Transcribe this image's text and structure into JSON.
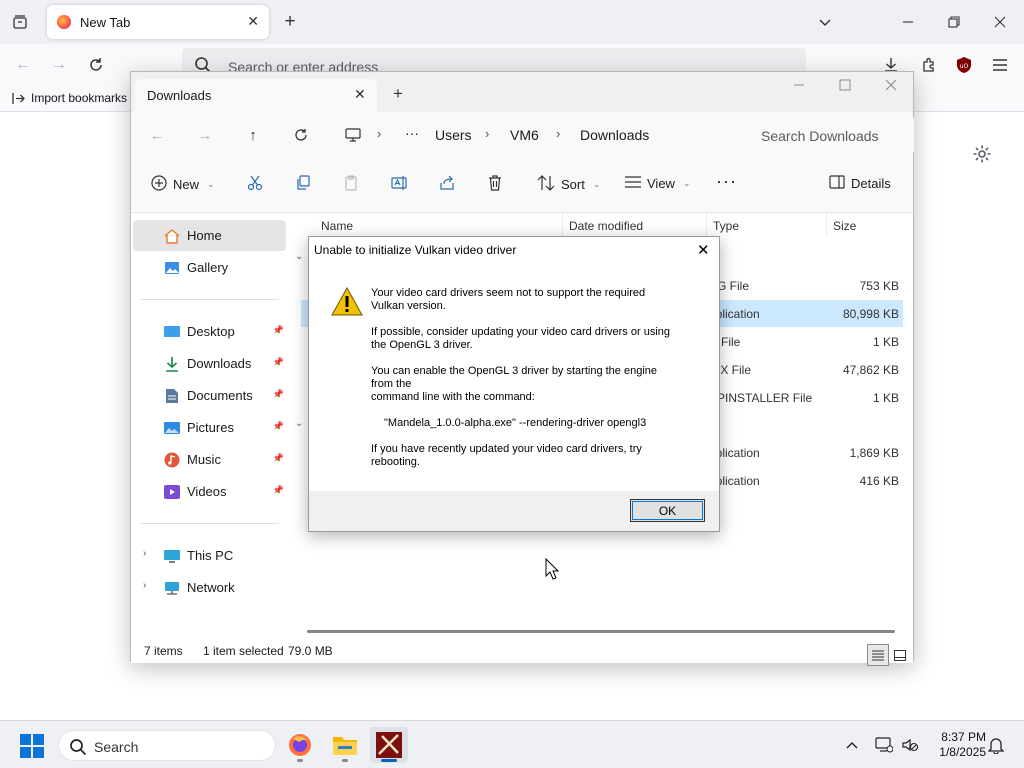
{
  "browser": {
    "tab_title": "New Tab",
    "address_placeholder": "Search or enter address",
    "import_bookmarks": "Import bookmarks"
  },
  "explorer": {
    "tab_title": "Downloads",
    "breadcrumb": [
      "Users",
      "VM6",
      "Downloads"
    ],
    "breadcrumb_more": "···",
    "search_placeholder": "Search Downloads",
    "toolbar": {
      "new_label": "New",
      "sort_label": "Sort",
      "view_label": "View",
      "more_label": "···",
      "details_label": "Details"
    },
    "nav": {
      "home": "Home",
      "gallery": "Gallery",
      "desktop": "Desktop",
      "downloads": "Downloads",
      "documents": "Documents",
      "pictures": "Pictures",
      "music": "Music",
      "videos": "Videos",
      "this_pc": "This PC",
      "network": "Network"
    },
    "columns": {
      "name": "Name",
      "date_modified": "Date modified",
      "type": "Type",
      "size": "Size"
    },
    "rows": [
      {
        "type": "PG File",
        "size": "753 KB"
      },
      {
        "type": "pplication",
        "size": "80,998 KB"
      },
      {
        "type": "D File",
        "size": "1 KB"
      },
      {
        "type": "SIX File",
        "size": "47,862 KB"
      },
      {
        "type": "PPINSTALLER File",
        "size": "1 KB"
      },
      {
        "type": "pplication",
        "size": "1,869 KB"
      },
      {
        "type": "pplication",
        "size": "416 KB"
      }
    ],
    "status": {
      "items": "7 items",
      "selected": "1 item selected",
      "selected_size": "79.0 MB"
    }
  },
  "dialog": {
    "title": "Unable to initialize Vulkan video driver",
    "para1": "Your video card drivers seem not to support the required\nVulkan version.",
    "para2": "If possible, consider updating your video card drivers or using\nthe OpenGL 3 driver.",
    "para3": "You can enable the OpenGL 3 driver by starting the engine\nfrom the\ncommand line with the command:",
    "command": "\"Mandela_1.0.0-alpha.exe\" --rendering-driver opengl3",
    "para4": "If you have recently updated your video card drivers, try\nrebooting.",
    "ok_label": "OK"
  },
  "taskbar": {
    "search_placeholder": "Search",
    "time": "8:37 PM",
    "date": "1/8/2025"
  },
  "colors": {
    "accent": "#0067c0",
    "selection": "#cce8ff",
    "warning": "#f2c200"
  }
}
